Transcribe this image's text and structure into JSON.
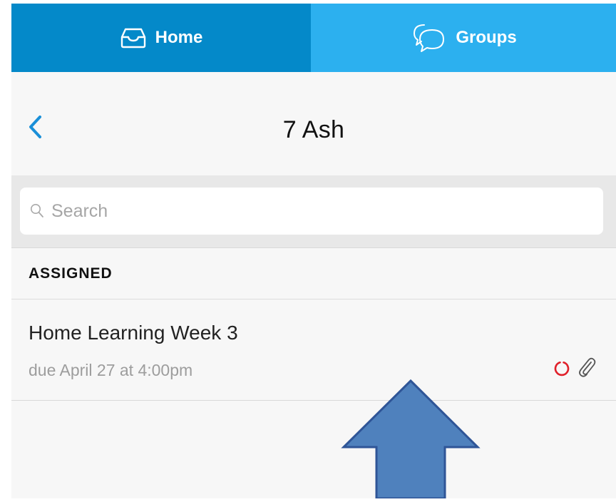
{
  "tabs": [
    {
      "label": "Home",
      "icon": "inbox-tray-icon",
      "active": true,
      "color": "#0489c9"
    },
    {
      "label": "Groups",
      "icon": "chat-bubbles-icon",
      "active": false,
      "color": "#2cb0ef"
    }
  ],
  "header": {
    "back_icon": "chevron-left-icon",
    "title": "7 Ash"
  },
  "search": {
    "placeholder": "Search",
    "value": ""
  },
  "sections": [
    {
      "header": "ASSIGNED",
      "items": [
        {
          "title": "Home Learning Week 3",
          "due": "due April 27 at 4:00pm",
          "status_icon": "incomplete-ring-icon",
          "status_color": "#e0202a",
          "attachment_icon": "paperclip-icon"
        }
      ]
    }
  ],
  "annotation": {
    "shape": "up-arrow",
    "fill": "#4f81bd",
    "stroke": "#2f5597"
  }
}
